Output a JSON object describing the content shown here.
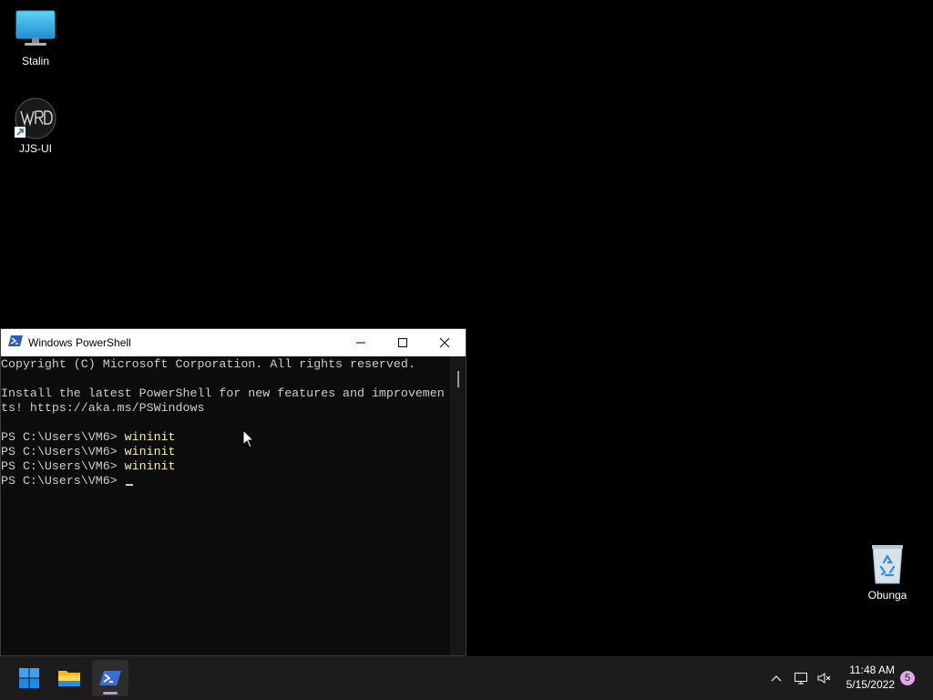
{
  "desktop": {
    "icons": [
      {
        "label": "Stalin",
        "icon": "monitor-icon"
      },
      {
        "label": "JJS-UI",
        "icon": "shortcut-icon"
      },
      {
        "label": "Obunga",
        "icon": "recycle-bin-icon"
      }
    ]
  },
  "window": {
    "title": "Windows PowerShell",
    "icon": "powershell-icon",
    "controls": [
      "minimize-icon",
      "maximize-icon",
      "close-icon"
    ],
    "console": {
      "copyright": "Copyright (C) Microsoft Corporation. All rights reserved.",
      "install_line1": "Install the latest PowerShell for new features and improvemen",
      "install_line2": "ts! https://aka.ms/PSWindows",
      "prompt": "PS C:\\Users\\VM6> ",
      "commands": [
        "wininit",
        "wininit",
        "wininit"
      ]
    }
  },
  "taskbar": {
    "apps": [
      "windows-start-icon",
      "file-explorer-icon",
      "powershell-icon"
    ],
    "tray": [
      "chevron-up-icon",
      "network-icon",
      "volume-muted-icon"
    ],
    "time": "11:48 AM",
    "date": "5/15/2022",
    "notification_count": "5"
  },
  "colors": {
    "console_bg": "#0c0c0c",
    "console_text": "#cccccc",
    "command_text": "#f9f1a5",
    "taskbar_bg": "#1c1c1c",
    "accent": "#d08bd8"
  }
}
